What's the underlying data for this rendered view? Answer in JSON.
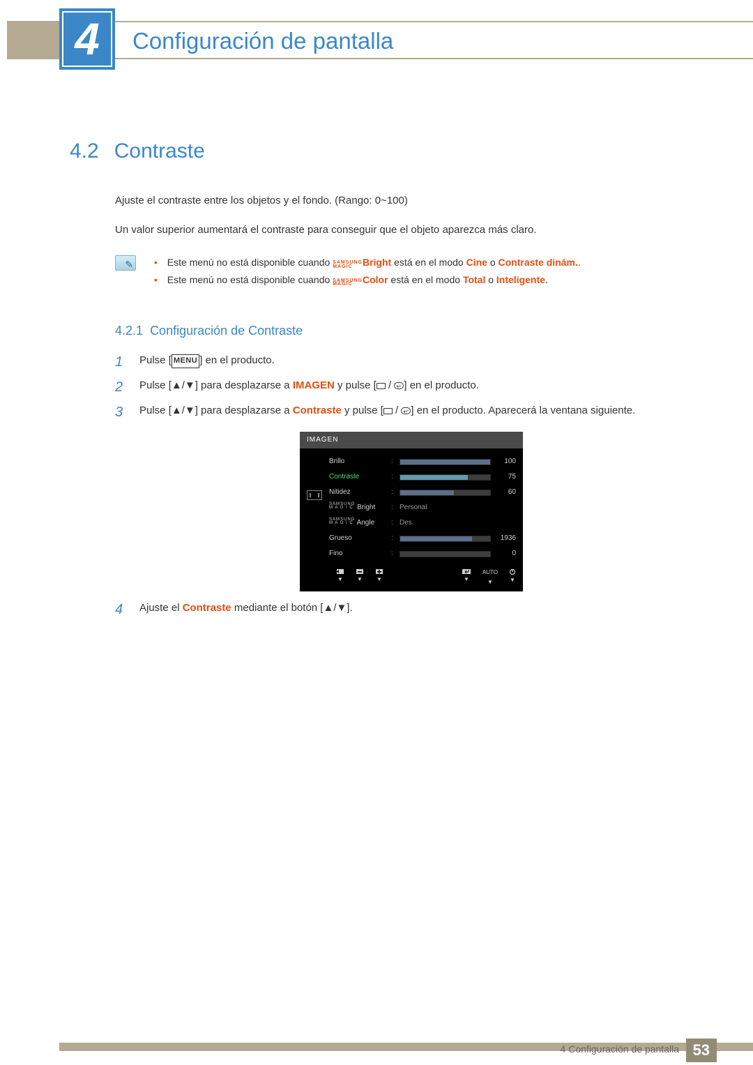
{
  "chapter": {
    "number": "4",
    "title": "Configuración de pantalla"
  },
  "section": {
    "number": "4.2",
    "title": "Contraste"
  },
  "intro": {
    "p1": "Ajuste el contraste entre los objetos y el fondo. (Rango: 0~100)",
    "p2": "Un valor superior aumentará el contraste para conseguir que el objeto aparezca más claro."
  },
  "notes": {
    "n1_a": "Este menú no está disponible cuando ",
    "n1_magic_top": "SAMSUNG",
    "n1_magic_bot": "MAGIC",
    "n1_b": "Bright",
    "n1_c": " está en el modo ",
    "n1_d": "Cine",
    "n1_e": " o ",
    "n1_f": "Contraste dinám.",
    "n1_g": ".",
    "n2_a": "Este menú no está disponible cuando ",
    "n2_b": "Color",
    "n2_c": " está en el modo ",
    "n2_d": "Total",
    "n2_e": " o ",
    "n2_f": "Inteligente",
    "n2_g": "."
  },
  "subsection": {
    "number": "4.2.1",
    "title": "Configuración de Contraste"
  },
  "steps": {
    "s1_a": "Pulse [",
    "s1_menu": "MENU",
    "s1_b": "] en el producto.",
    "s2_a": "Pulse [▲/▼] para desplazarse a ",
    "s2_b": "IMAGEN",
    "s2_c": " y pulse [",
    "s2_d": "] en el producto.",
    "s3_a": "Pulse [▲/▼] para desplazarse a ",
    "s3_b": "Contraste",
    "s3_c": " y pulse [",
    "s3_d": "] en el producto. Aparecerá la ventana siguiente.",
    "s4_a": "Ajuste el ",
    "s4_b": "Contraste",
    "s4_c": " mediante el botón [▲/▼]."
  },
  "osd": {
    "title": "IMAGEN",
    "rows": [
      {
        "label": "Brillo",
        "type": "bar",
        "fill": 100,
        "value": "100",
        "selected": false
      },
      {
        "label": "Contraste",
        "type": "bar",
        "fill": 75,
        "value": "75",
        "selected": true
      },
      {
        "label": "Nitidez",
        "type": "bar",
        "fill": 60,
        "value": "60",
        "selected": false
      },
      {
        "label": "Bright",
        "type": "text",
        "text": "Personal",
        "magic": true
      },
      {
        "label": "Angle",
        "type": "text",
        "text": "Des.",
        "magic": true
      },
      {
        "label": "Grueso",
        "type": "bar",
        "fill": 80,
        "value": "1936",
        "selected": false
      },
      {
        "label": "Fino",
        "type": "bar",
        "fill": 0,
        "value": "0",
        "selected": false
      }
    ],
    "footer_auto": "AUTO"
  },
  "footer": {
    "text": "4 Configuración de pantalla",
    "page": "53"
  }
}
